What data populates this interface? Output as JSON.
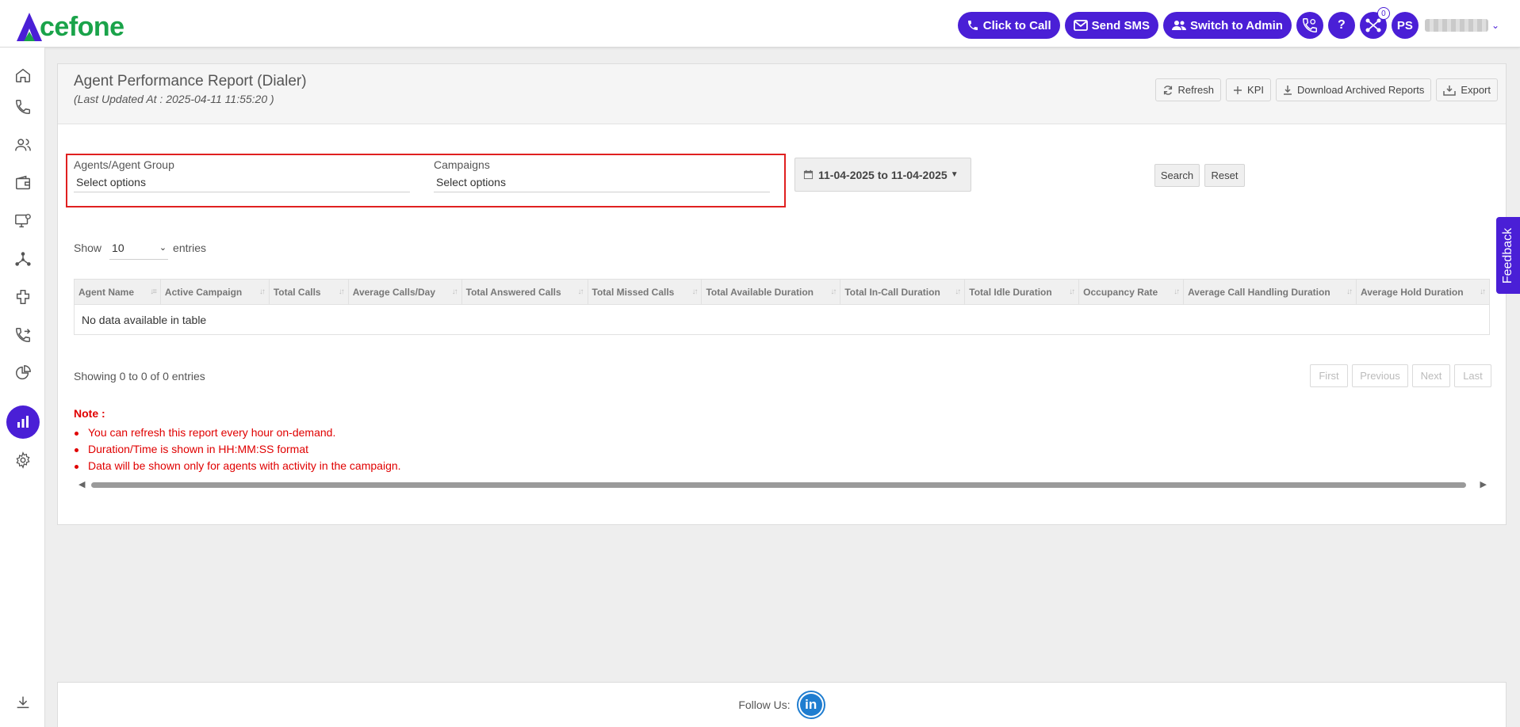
{
  "brand": {
    "logo_text": "cefone",
    "accent": "#4a1fd6",
    "green": "#1aa34a"
  },
  "header": {
    "click_to_call": "Click to Call",
    "send_sms": "Send SMS",
    "switch_to_admin": "Switch to Admin",
    "help_symbol": "?",
    "notification_count": "0",
    "avatar_initials": "PS"
  },
  "sidebar": {
    "items": [
      "home-icon",
      "phone-icon",
      "users-icon",
      "wallet-icon",
      "monitor-settings-icon",
      "network-icon",
      "integration-icon",
      "call-transfer-icon",
      "pie-chart-icon",
      "reports-icon",
      "settings-icon",
      "download-icon"
    ],
    "active": "reports-icon"
  },
  "report": {
    "title": "Agent Performance Report (Dialer)",
    "last_updated": "(Last Updated At : 2025-04-11 11:55:20 )",
    "toolbar": {
      "refresh": "Refresh",
      "kpi": "KPI",
      "download_archived": "Download Archived Reports",
      "export": "Export"
    }
  },
  "filters": {
    "agents_label": "Agents/Agent Group",
    "agents_value": "Select options",
    "campaigns_label": "Campaigns",
    "campaigns_value": "Select options",
    "date_range": "11-04-2025 to 11-04-2025",
    "search": "Search",
    "reset": "Reset"
  },
  "table": {
    "show_label": "Show",
    "entries_label": "entries",
    "page_length": "10",
    "columns": [
      "Agent Name",
      "Active Campaign",
      "Total Calls",
      "Average Calls/Day",
      "Total Answered Calls",
      "Total Missed Calls",
      "Total Available Duration",
      "Total In-Call Duration",
      "Total Idle Duration",
      "Occupancy Rate",
      "Average Call Handling Duration",
      "Average Hold Duration"
    ],
    "empty": "No data available in table",
    "info": "Showing 0 to 0 of 0 entries",
    "pager": {
      "first": "First",
      "previous": "Previous",
      "next": "Next",
      "last": "Last"
    }
  },
  "notes": {
    "heading": "Note :",
    "items": [
      "You can refresh this report every hour on-demand.",
      "Duration/Time is shown in HH:MM:SS format",
      "Data will be shown only for agents with activity in the campaign."
    ]
  },
  "feedback": "Feedback",
  "footer": {
    "follow_us": "Follow Us:",
    "linkedin": "in"
  }
}
